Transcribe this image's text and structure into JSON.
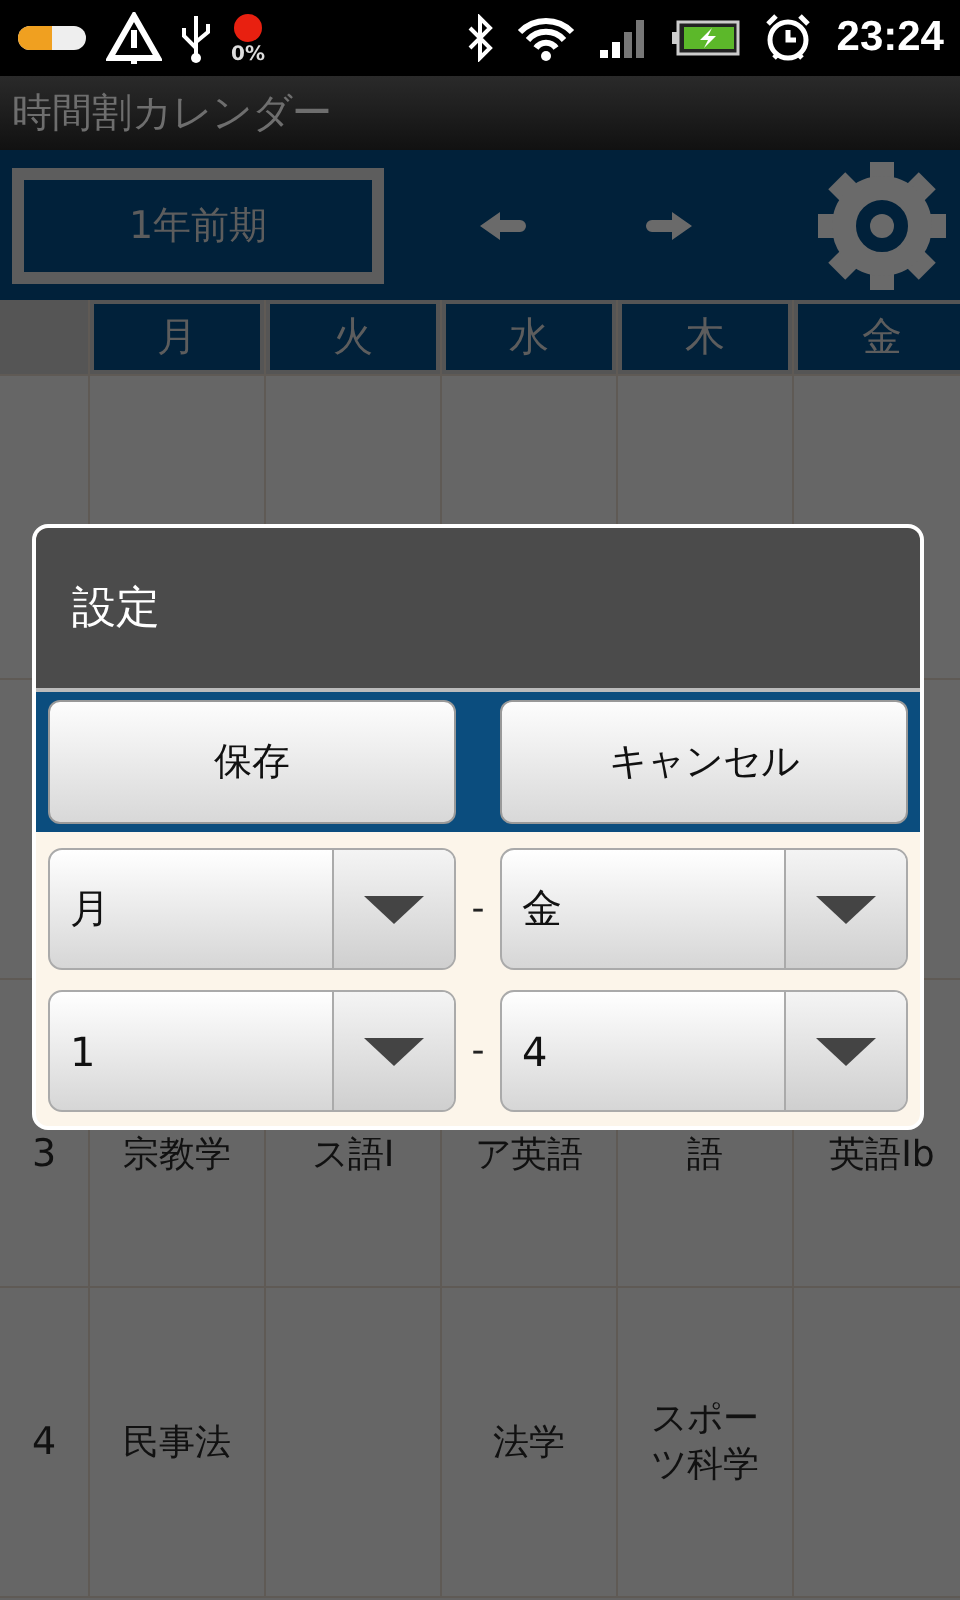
{
  "status_bar": {
    "cpu_reading": "0%",
    "time": "23:24"
  },
  "app_title": "時間割カレンダー",
  "toolbar": {
    "term": "1年前期"
  },
  "days": [
    "月",
    "火",
    "水",
    "木",
    "金"
  ],
  "rows": [
    {
      "number": "3",
      "cells": [
        "宗教学",
        "ス語Ⅰ",
        "ア英語",
        "語",
        "英語Ⅰb"
      ]
    },
    {
      "number": "4",
      "cells": [
        "民事法",
        null,
        "法学",
        "スポーツ科学",
        null
      ]
    }
  ],
  "dialog": {
    "title": "設定",
    "buttons": [
      "保存",
      "キャンセル"
    ],
    "ranges": [
      {
        "from": "月",
        "separator": "-",
        "to": "金"
      },
      {
        "from": "1",
        "separator": "-",
        "to": "4"
      }
    ]
  }
}
